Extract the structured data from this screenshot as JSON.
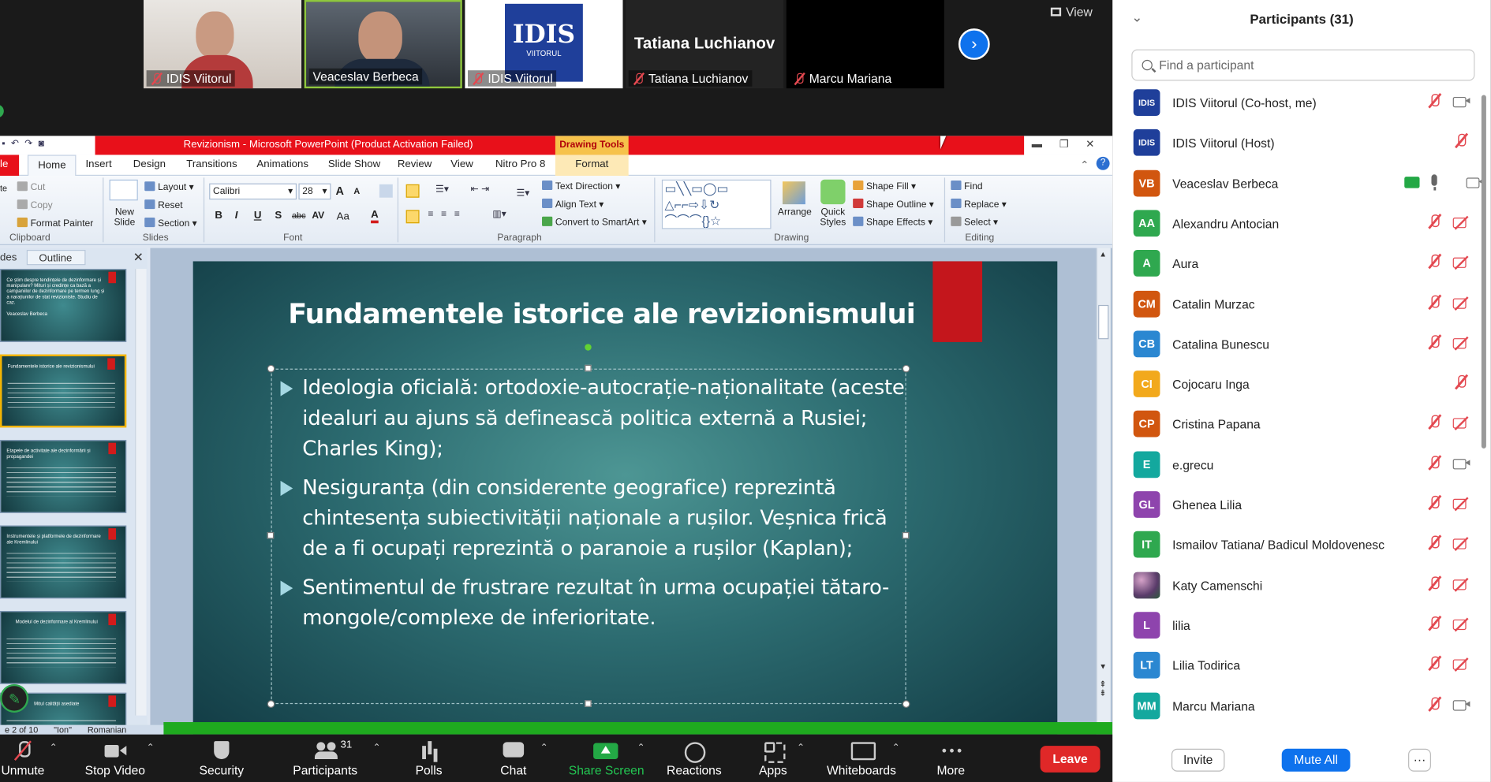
{
  "video_strip": {
    "tiles": [
      {
        "name": "IDIS Viitorul"
      },
      {
        "name": "Veaceslav Berbeca"
      },
      {
        "name": "IDIS Viitorul",
        "logo_text": "IDIS",
        "logo_sub": "VIITORUL"
      },
      {
        "name": "Tatiana Luchianov",
        "big_name": "Tatiana Luchianov"
      },
      {
        "name": "Marcu Mariana"
      }
    ],
    "view_label": "View"
  },
  "powerpoint": {
    "window_title": "Revizionism - Microsoft PowerPoint (Product Activation Failed)",
    "drawing_tools": "Drawing Tools",
    "tabs": [
      "le",
      "Home",
      "Insert",
      "Design",
      "Transitions",
      "Animations",
      "Slide Show",
      "Review",
      "View",
      "Nitro Pro 8",
      "Format"
    ],
    "ribbon": {
      "clipboard": {
        "cut": "Cut",
        "copy": "Copy",
        "format_painter": "Format Painter",
        "paste_frag": "te",
        "label": "Clipboard"
      },
      "slides": {
        "new_slide": "New Slide",
        "layout": "Layout",
        "reset": "Reset",
        "section": "Section",
        "label": "Slides"
      },
      "font": {
        "name": "Calibri",
        "size": "28",
        "label": "Font",
        "bold": "B",
        "italic": "I",
        "underline": "U",
        "shadow": "S",
        "strike": "abc",
        "spacing": "AV",
        "case": "Aa",
        "color": "A",
        "grow": "A",
        "shrink": "A"
      },
      "paragraph": {
        "text_direction": "Text Direction",
        "align_text": "Align Text",
        "smartart": "Convert to SmartArt",
        "label": "Paragraph"
      },
      "drawing": {
        "arrange": "Arrange",
        "quick_styles": "Quick Styles",
        "shape_fill": "Shape Fill",
        "shape_outline": "Shape Outline",
        "shape_effects": "Shape Effects",
        "label": "Drawing"
      },
      "editing": {
        "find": "Find",
        "replace": "Replace",
        "select": "Select",
        "label": "Editing"
      }
    },
    "left_pane": {
      "tab_slides": "des",
      "tab_outline": "Outline"
    },
    "thumbnails": [
      {
        "title": "Ce știm despre tendințele de dezinformare și manipulare? Mituri și credințe ca bază a campaniilor de dezinformare pe termen lung și a narațiunilor de stat revizioniste. Studiu de caz.",
        "sub": "Veaceslav Berbeca"
      },
      {
        "title": "Fundamentele istorice ale revizionismului",
        "sub": ""
      },
      {
        "title": "Etapele de activitate ale dezinformării și propagandei",
        "sub": ""
      },
      {
        "title": "Instrumentele și platformele de dezinformare ale Kremlinului",
        "sub": ""
      },
      {
        "title": "Modelul de dezinformare al Kremlinului",
        "sub": ""
      },
      {
        "title": "Mitul calității asediate",
        "sub": ""
      }
    ],
    "slide": {
      "title": "Fundamentele istorice ale revizionismului",
      "bullets": [
        "Ideologia oficială: ortodoxie-autocrație-naționalitate (aceste idealuri au ajuns să definească politica externă a Rusiei; Charles King);",
        "Nesiguranța (din considerente geografice) reprezintă chintesența subiectivității naționale a rușilor. Veșnica frică de a fi ocupați reprezintă o paranoie a rușilor (Kaplan);",
        "Sentimentul de frustrare rezultat în urma ocupației tătaro-mongole/complexe de inferioritate."
      ]
    },
    "status": {
      "slide": "e 2 of 10",
      "theme": "\"Ion\"",
      "lang": "Romanian"
    }
  },
  "participants": {
    "title": "Participants (31)",
    "search_placeholder": "Find a participant",
    "list": [
      {
        "initials": "IDIS",
        "name": "IDIS Viitorul (Co-host, me)",
        "color": "#1f3f9a",
        "mic": "off",
        "cam": "on",
        "logo": true
      },
      {
        "initials": "IDIS",
        "name": "IDIS Viitorul (Host)",
        "color": "#1f3f9a",
        "mic": "off",
        "cam": "none",
        "logo": true
      },
      {
        "initials": "VB",
        "name": "Veaceslav Berbeca",
        "color": "#d1560f",
        "mic": "on",
        "cam": "on",
        "sharing": true
      },
      {
        "initials": "AA",
        "name": "Alexandru Antocian",
        "color": "#2fa84f",
        "mic": "off",
        "cam": "off"
      },
      {
        "initials": "A",
        "name": "Aura",
        "color": "#2fa84f",
        "mic": "off",
        "cam": "off"
      },
      {
        "initials": "CM",
        "name": "Catalin Murzac",
        "color": "#d1560f",
        "mic": "off",
        "cam": "off"
      },
      {
        "initials": "CB",
        "name": "Catalina Bunescu",
        "color": "#2b87d1",
        "mic": "off",
        "cam": "off"
      },
      {
        "initials": "CI",
        "name": "Cojocaru Inga",
        "color": "#f2a91c",
        "mic": "off",
        "cam": "none"
      },
      {
        "initials": "CP",
        "name": "Cristina Papana",
        "color": "#d1560f",
        "mic": "off",
        "cam": "off"
      },
      {
        "initials": "E",
        "name": "e.grecu",
        "color": "#13a89e",
        "mic": "off",
        "cam": "on"
      },
      {
        "initials": "GL",
        "name": "Ghenea Lilia",
        "color": "#8e44ad",
        "mic": "off",
        "cam": "off"
      },
      {
        "initials": "IT",
        "name": "Ismailov Tatiana/ Badicul Moldovenesc",
        "color": "#2fa84f",
        "mic": "off",
        "cam": "off"
      },
      {
        "initials": "",
        "name": "Katy Camenschi",
        "color": "#7b5a8a",
        "mic": "off",
        "cam": "off",
        "photo": true
      },
      {
        "initials": "L",
        "name": "lilia",
        "color": "#8e44ad",
        "mic": "off",
        "cam": "off"
      },
      {
        "initials": "LT",
        "name": "Lilia Todirica",
        "color": "#2b87d1",
        "mic": "off",
        "cam": "off"
      },
      {
        "initials": "MM",
        "name": "Marcu Mariana",
        "color": "#13a89e",
        "mic": "off",
        "cam": "on"
      }
    ],
    "invite": "Invite",
    "mute_all": "Mute All",
    "more": "···"
  },
  "toolbar": {
    "unmute": "Unmute",
    "stop_video": "Stop Video",
    "security": "Security",
    "participants": "Participants",
    "participants_count": "31",
    "polls": "Polls",
    "chat": "Chat",
    "share_screen": "Share Screen",
    "reactions": "Reactions",
    "apps": "Apps",
    "whiteboards": "Whiteboards",
    "more": "More",
    "leave": "Leave"
  }
}
